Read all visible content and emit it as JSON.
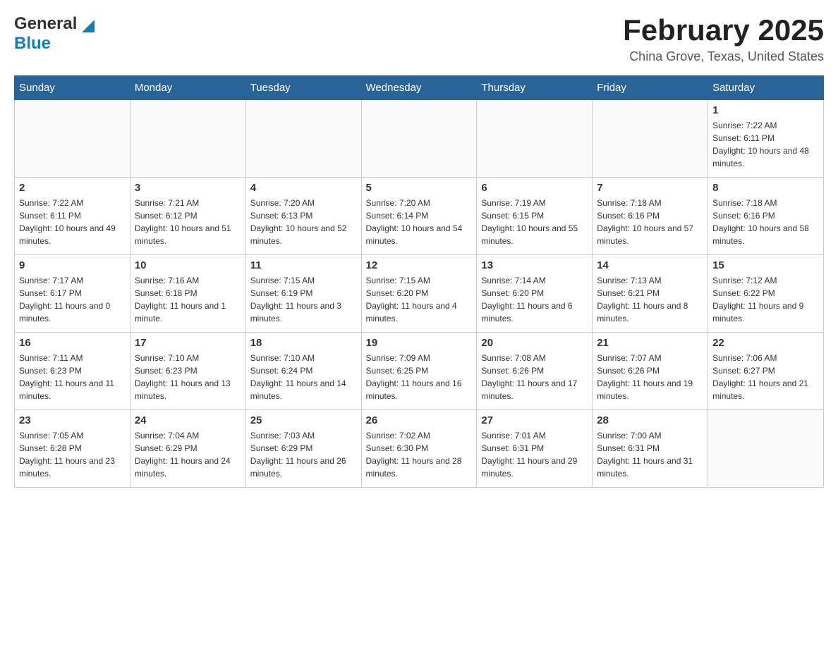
{
  "header": {
    "logo_general": "General",
    "logo_blue": "Blue",
    "month_year": "February 2025",
    "location": "China Grove, Texas, United States"
  },
  "days_of_week": [
    "Sunday",
    "Monday",
    "Tuesday",
    "Wednesday",
    "Thursday",
    "Friday",
    "Saturday"
  ],
  "weeks": [
    [
      {
        "day": "",
        "sunrise": "",
        "sunset": "",
        "daylight": ""
      },
      {
        "day": "",
        "sunrise": "",
        "sunset": "",
        "daylight": ""
      },
      {
        "day": "",
        "sunrise": "",
        "sunset": "",
        "daylight": ""
      },
      {
        "day": "",
        "sunrise": "",
        "sunset": "",
        "daylight": ""
      },
      {
        "day": "",
        "sunrise": "",
        "sunset": "",
        "daylight": ""
      },
      {
        "day": "",
        "sunrise": "",
        "sunset": "",
        "daylight": ""
      },
      {
        "day": "1",
        "sunrise": "Sunrise: 7:22 AM",
        "sunset": "Sunset: 6:11 PM",
        "daylight": "Daylight: 10 hours and 48 minutes."
      }
    ],
    [
      {
        "day": "2",
        "sunrise": "Sunrise: 7:22 AM",
        "sunset": "Sunset: 6:11 PM",
        "daylight": "Daylight: 10 hours and 49 minutes."
      },
      {
        "day": "3",
        "sunrise": "Sunrise: 7:21 AM",
        "sunset": "Sunset: 6:12 PM",
        "daylight": "Daylight: 10 hours and 51 minutes."
      },
      {
        "day": "4",
        "sunrise": "Sunrise: 7:20 AM",
        "sunset": "Sunset: 6:13 PM",
        "daylight": "Daylight: 10 hours and 52 minutes."
      },
      {
        "day": "5",
        "sunrise": "Sunrise: 7:20 AM",
        "sunset": "Sunset: 6:14 PM",
        "daylight": "Daylight: 10 hours and 54 minutes."
      },
      {
        "day": "6",
        "sunrise": "Sunrise: 7:19 AM",
        "sunset": "Sunset: 6:15 PM",
        "daylight": "Daylight: 10 hours and 55 minutes."
      },
      {
        "day": "7",
        "sunrise": "Sunrise: 7:18 AM",
        "sunset": "Sunset: 6:16 PM",
        "daylight": "Daylight: 10 hours and 57 minutes."
      },
      {
        "day": "8",
        "sunrise": "Sunrise: 7:18 AM",
        "sunset": "Sunset: 6:16 PM",
        "daylight": "Daylight: 10 hours and 58 minutes."
      }
    ],
    [
      {
        "day": "9",
        "sunrise": "Sunrise: 7:17 AM",
        "sunset": "Sunset: 6:17 PM",
        "daylight": "Daylight: 11 hours and 0 minutes."
      },
      {
        "day": "10",
        "sunrise": "Sunrise: 7:16 AM",
        "sunset": "Sunset: 6:18 PM",
        "daylight": "Daylight: 11 hours and 1 minute."
      },
      {
        "day": "11",
        "sunrise": "Sunrise: 7:15 AM",
        "sunset": "Sunset: 6:19 PM",
        "daylight": "Daylight: 11 hours and 3 minutes."
      },
      {
        "day": "12",
        "sunrise": "Sunrise: 7:15 AM",
        "sunset": "Sunset: 6:20 PM",
        "daylight": "Daylight: 11 hours and 4 minutes."
      },
      {
        "day": "13",
        "sunrise": "Sunrise: 7:14 AM",
        "sunset": "Sunset: 6:20 PM",
        "daylight": "Daylight: 11 hours and 6 minutes."
      },
      {
        "day": "14",
        "sunrise": "Sunrise: 7:13 AM",
        "sunset": "Sunset: 6:21 PM",
        "daylight": "Daylight: 11 hours and 8 minutes."
      },
      {
        "day": "15",
        "sunrise": "Sunrise: 7:12 AM",
        "sunset": "Sunset: 6:22 PM",
        "daylight": "Daylight: 11 hours and 9 minutes."
      }
    ],
    [
      {
        "day": "16",
        "sunrise": "Sunrise: 7:11 AM",
        "sunset": "Sunset: 6:23 PM",
        "daylight": "Daylight: 11 hours and 11 minutes."
      },
      {
        "day": "17",
        "sunrise": "Sunrise: 7:10 AM",
        "sunset": "Sunset: 6:23 PM",
        "daylight": "Daylight: 11 hours and 13 minutes."
      },
      {
        "day": "18",
        "sunrise": "Sunrise: 7:10 AM",
        "sunset": "Sunset: 6:24 PM",
        "daylight": "Daylight: 11 hours and 14 minutes."
      },
      {
        "day": "19",
        "sunrise": "Sunrise: 7:09 AM",
        "sunset": "Sunset: 6:25 PM",
        "daylight": "Daylight: 11 hours and 16 minutes."
      },
      {
        "day": "20",
        "sunrise": "Sunrise: 7:08 AM",
        "sunset": "Sunset: 6:26 PM",
        "daylight": "Daylight: 11 hours and 17 minutes."
      },
      {
        "day": "21",
        "sunrise": "Sunrise: 7:07 AM",
        "sunset": "Sunset: 6:26 PM",
        "daylight": "Daylight: 11 hours and 19 minutes."
      },
      {
        "day": "22",
        "sunrise": "Sunrise: 7:06 AM",
        "sunset": "Sunset: 6:27 PM",
        "daylight": "Daylight: 11 hours and 21 minutes."
      }
    ],
    [
      {
        "day": "23",
        "sunrise": "Sunrise: 7:05 AM",
        "sunset": "Sunset: 6:28 PM",
        "daylight": "Daylight: 11 hours and 23 minutes."
      },
      {
        "day": "24",
        "sunrise": "Sunrise: 7:04 AM",
        "sunset": "Sunset: 6:29 PM",
        "daylight": "Daylight: 11 hours and 24 minutes."
      },
      {
        "day": "25",
        "sunrise": "Sunrise: 7:03 AM",
        "sunset": "Sunset: 6:29 PM",
        "daylight": "Daylight: 11 hours and 26 minutes."
      },
      {
        "day": "26",
        "sunrise": "Sunrise: 7:02 AM",
        "sunset": "Sunset: 6:30 PM",
        "daylight": "Daylight: 11 hours and 28 minutes."
      },
      {
        "day": "27",
        "sunrise": "Sunrise: 7:01 AM",
        "sunset": "Sunset: 6:31 PM",
        "daylight": "Daylight: 11 hours and 29 minutes."
      },
      {
        "day": "28",
        "sunrise": "Sunrise: 7:00 AM",
        "sunset": "Sunset: 6:31 PM",
        "daylight": "Daylight: 11 hours and 31 minutes."
      },
      {
        "day": "",
        "sunrise": "",
        "sunset": "",
        "daylight": ""
      }
    ]
  ]
}
